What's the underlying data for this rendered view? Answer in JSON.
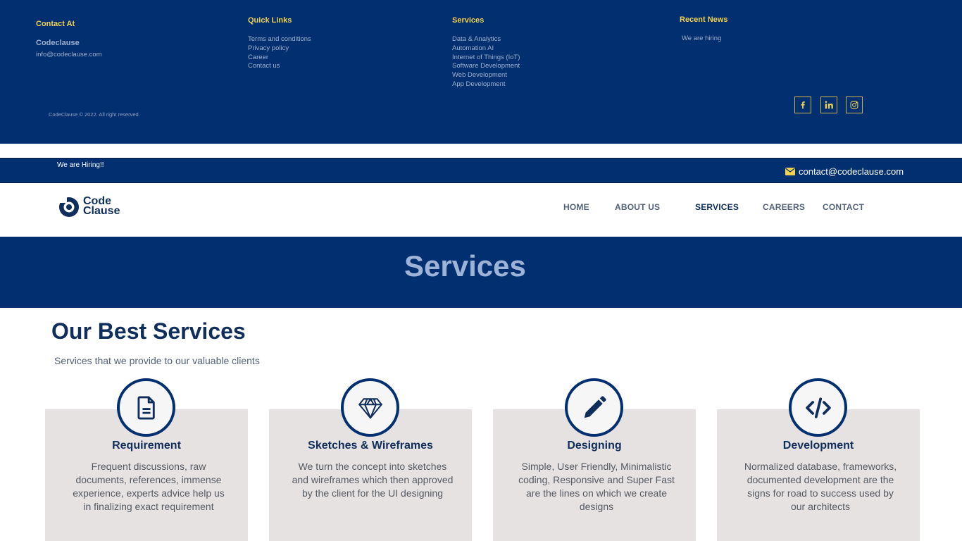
{
  "footer": {
    "contact_heading": "Contact At",
    "brand": "Codeclause",
    "email": "info@codeclause.com",
    "quick_heading": "Quick Links",
    "quick_links": [
      "Terms and conditions",
      "Privacy policy",
      "Career",
      "Contact us"
    ],
    "services_heading": "Services",
    "services_links": [
      "Data & Analytics",
      "Automation AI",
      "Internet of Things (IoT)",
      "Software Development",
      "Web Development",
      "App Development"
    ],
    "news_heading": "Recent News",
    "news_links": [
      "We are hiring"
    ],
    "copyright": "CodeClause © 2022. All right reserved.",
    "social_icons": [
      "facebook-icon",
      "linkedin-icon",
      "instagram-icon"
    ]
  },
  "topbar": {
    "hiring": "We are Hiring!!",
    "email": "contact@codeclause.com"
  },
  "navbar": {
    "logo_line1": "Code",
    "logo_line2": "Clause",
    "items": [
      "HOME",
      "ABOUT US",
      "SERVICES",
      "CAREERS",
      "CONTACT"
    ],
    "active": "SERVICES"
  },
  "banner": {
    "title": "Services"
  },
  "section": {
    "title": "Our Best Services",
    "subtitle": "Services that we provide to our valuable clients"
  },
  "cards": [
    {
      "icon": "document-icon",
      "title": "Requirement",
      "text": "Frequent discussions, raw documents, references, immense experience, experts advice help us in finalizing exact requirement"
    },
    {
      "icon": "diamond-icon",
      "title": "Sketches & Wireframes",
      "text": "We turn the concept into sketches and wireframes which then approved by the client for the UI designing"
    },
    {
      "icon": "pencil-icon",
      "title": "Designing",
      "text": "Simple, User Friendly, Minimalistic coding, Responsive and Super Fast are the lines on which we create designs"
    },
    {
      "icon": "code-icon",
      "title": "Development",
      "text": "Normalized database, frameworks, documented development are the signs for road to success used by our architects"
    }
  ],
  "colors": {
    "navy": "#012f70",
    "accent_yellow": "#f1d24f",
    "card_bg": "#e6e2e1",
    "heading": "#0f2e5c"
  }
}
